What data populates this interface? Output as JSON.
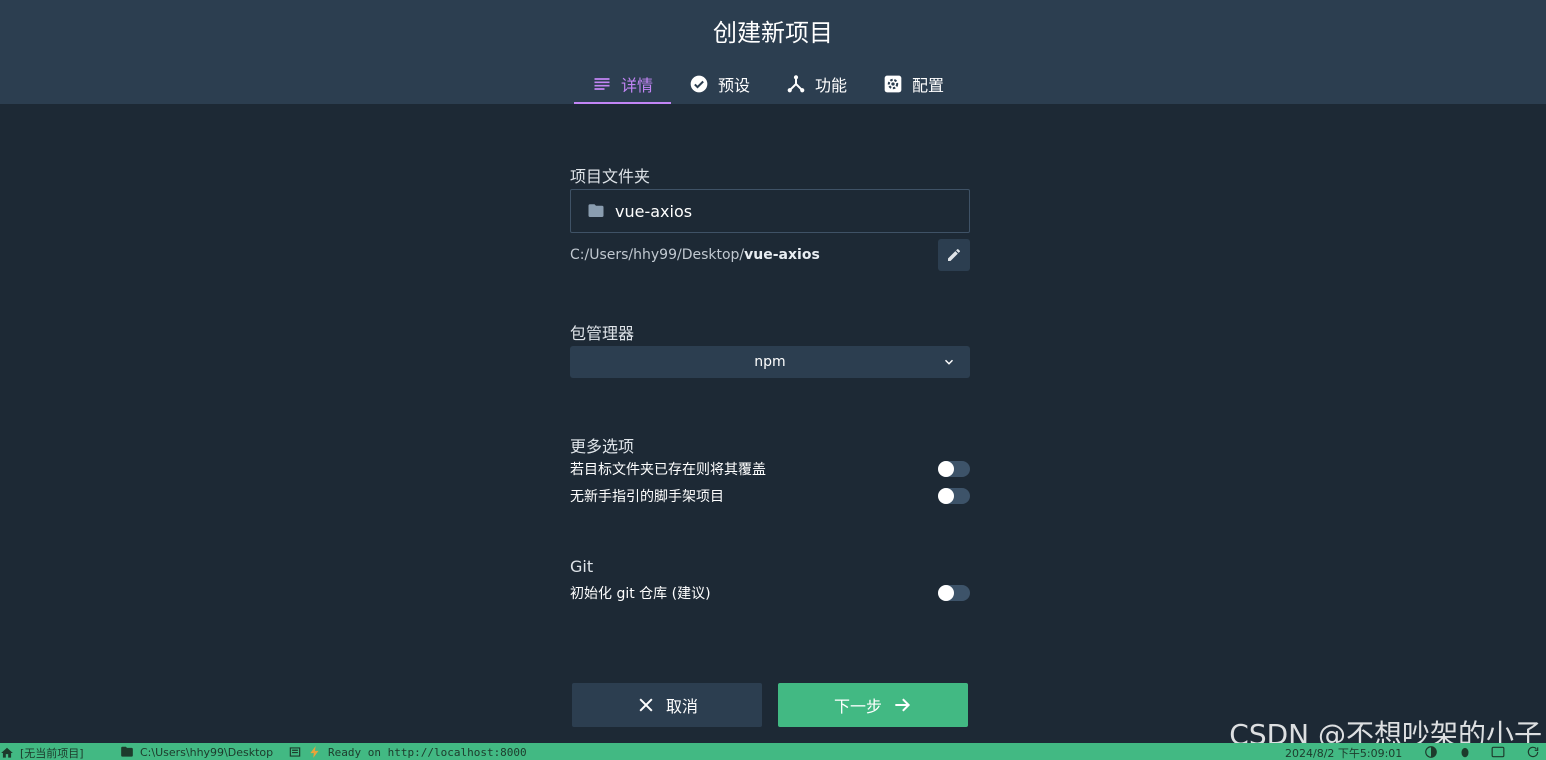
{
  "header": {
    "title": "创建新项目",
    "tabs": [
      {
        "label": "详情",
        "icon": "details-list-icon",
        "active": true
      },
      {
        "label": "预设",
        "icon": "check-circle-icon",
        "active": false
      },
      {
        "label": "功能",
        "icon": "merge-type-icon",
        "active": false
      },
      {
        "label": "配置",
        "icon": "settings-app-icon",
        "active": false
      }
    ],
    "active_color": "#c285f5"
  },
  "folder": {
    "label": "项目文件夹",
    "value": "vue-axios",
    "path_prefix": "C:/Users/hhy99/Desktop/",
    "path_name": "vue-axios"
  },
  "package_manager": {
    "label": "包管理器",
    "selected": "npm"
  },
  "more_options": {
    "label": "更多选项",
    "items": [
      {
        "label": "若目标文件夹已存在则将其覆盖",
        "enabled": false
      },
      {
        "label": "无新手指引的脚手架项目",
        "enabled": false
      }
    ]
  },
  "git": {
    "label": "Git",
    "items": [
      {
        "label": "初始化 git 仓库 (建议)",
        "enabled": false
      }
    ]
  },
  "actions": {
    "cancel": "取消",
    "next": "下一步",
    "next_color": "#42b983"
  },
  "statusbar": {
    "project": "[无当前项目]",
    "folder": "C:\\Users\\hhy99\\Desktop",
    "log": "Ready on http://localhost:8000",
    "datetime": "2024/8/2 下午5:09:01"
  },
  "watermark": "CSDN @不想吵架的小子"
}
